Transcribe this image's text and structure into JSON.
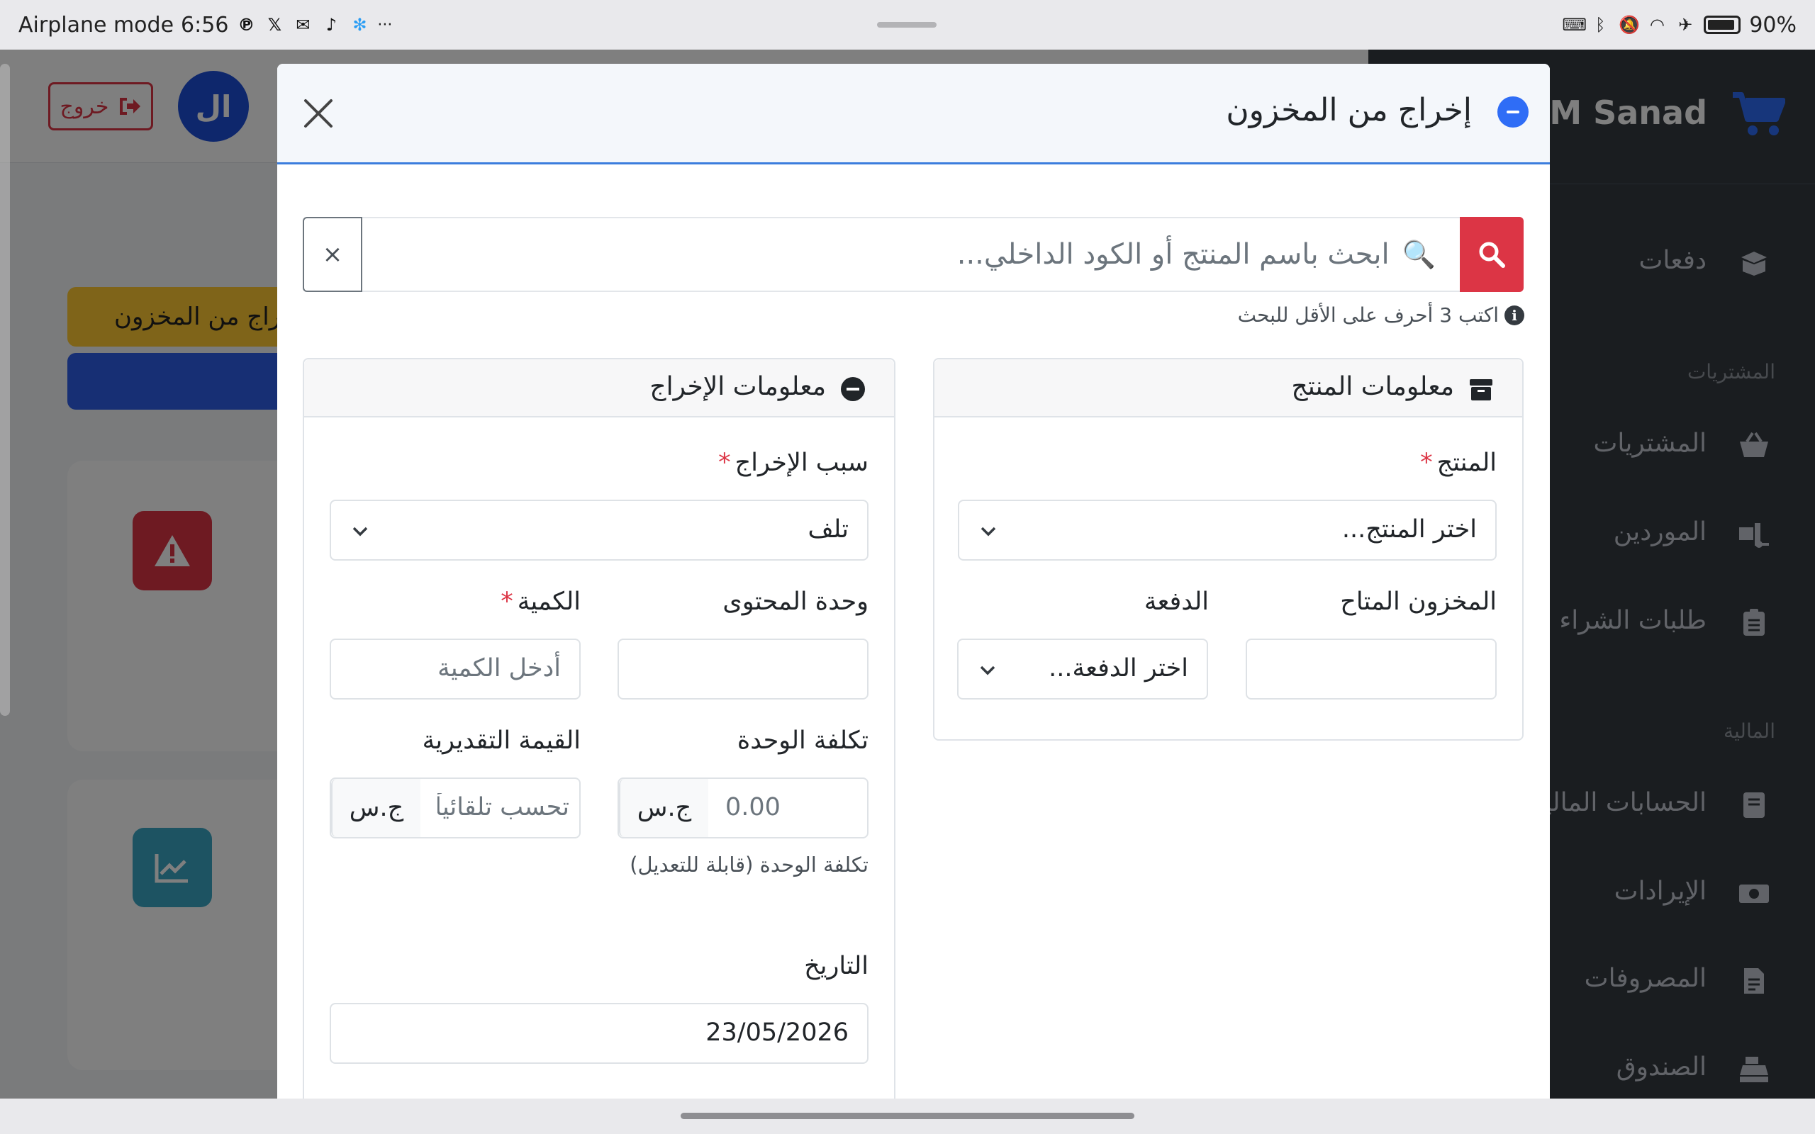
{
  "status_bar": {
    "mode": "Airplane mode",
    "time": "6:56",
    "battery": "90%",
    "notification_icons": [
      "pinterest-icon",
      "x-icon",
      "mail-icon",
      "tiktok-icon",
      "snowflake-icon"
    ],
    "more": "···"
  },
  "background": {
    "logout_label": "خروج",
    "avatar_initials": "ال",
    "stock_out_button": "إخراج من المخزون",
    "brand_name": "ABM Sanad",
    "sidebar": {
      "item_payments": "دفعات",
      "header_purchases": "المشتريات",
      "item_purchases": "المشتريات",
      "item_suppliers": "الموردين",
      "item_purchase_orders": "طلبات الشراء",
      "header_finance": "المالية",
      "item_accounts": "الحسابات المالية",
      "item_revenues": "الإيرادات",
      "item_expenses": "المصروفات",
      "item_cashbox": "الصندوق"
    },
    "colors": {
      "sidebar": "#343a40",
      "brand_blue": "#1d4ed8",
      "warning": "#ffc933",
      "danger": "#dc3545",
      "info": "#3aa6c4"
    }
  },
  "modal": {
    "title": "إخراج من المخزون",
    "search": {
      "placeholder": "ابحث باسم المنتج أو الكود الداخلي...",
      "hint": "اكتب 3 أحرف على الأقل للبحث",
      "clear_label": "×"
    },
    "product_card": {
      "title": "معلومات المنتج",
      "product_label": "المنتج",
      "product_value": "اختر المنتج...",
      "available_stock_label": "المخزون المتاح",
      "available_stock_value": "",
      "batch_label": "الدفعة",
      "batch_value": "اختر الدفعة..."
    },
    "output_card": {
      "title": "معلومات الإخراج",
      "reason_label": "سبب الإخراج",
      "reason_value": "تلف",
      "content_unit_label": "وحدة المحتوى",
      "content_unit_value": "",
      "quantity_label": "الكمية",
      "quantity_placeholder": "أدخل الكمية",
      "unit_cost_label": "تكلفة الوحدة",
      "unit_cost_placeholder": "0.00",
      "unit_cost_currency": "ج.س",
      "unit_cost_help": "تكلفة الوحدة (قابلة للتعديل)",
      "estimated_value_label": "القيمة التقديرية",
      "estimated_value_placeholder": "تحسب تلقائياً",
      "estimated_value_currency": "ج.س",
      "date_label": "التاريخ",
      "date_value": "23/05/2026"
    }
  }
}
